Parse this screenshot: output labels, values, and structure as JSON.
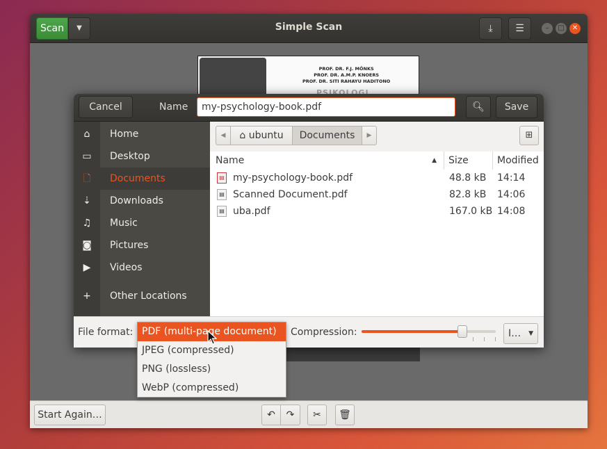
{
  "app": {
    "title": "Simple Scan",
    "scan_label": "Scan"
  },
  "preview_text": {
    "line1": "PROF. DR. F.J. MÖNKS",
    "line2": "PROF. DR. A.M.P. KNOERS",
    "line3": "PROF. DR. SITI RAHAYU HADITONO",
    "title": "PSIKOLOGI"
  },
  "footer": {
    "start_again_label": "Start Again…"
  },
  "dialog": {
    "cancel_label": "Cancel",
    "name_label": "Name",
    "name_value": "my-psychology-book.pdf",
    "save_label": "Save"
  },
  "sidebar": {
    "items": [
      {
        "label": "Home",
        "icon": "home-icon"
      },
      {
        "label": "Desktop",
        "icon": "desktop-icon"
      },
      {
        "label": "Documents",
        "icon": "document-icon"
      },
      {
        "label": "Downloads",
        "icon": "download-icon"
      },
      {
        "label": "Music",
        "icon": "music-icon"
      },
      {
        "label": "Pictures",
        "icon": "camera-icon"
      },
      {
        "label": "Videos",
        "icon": "video-icon"
      },
      {
        "label": "Other Locations",
        "icon": "plus-icon"
      }
    ]
  },
  "pathbar": {
    "segments": [
      "ubuntu",
      "Documents"
    ]
  },
  "columns": {
    "name": "Name",
    "size": "Size",
    "modified": "Modified"
  },
  "files": [
    {
      "name": "my-psychology-book.pdf",
      "size": "48.8 kB",
      "modified": "14:14"
    },
    {
      "name": "Scanned Document.pdf",
      "size": "82.8 kB",
      "modified": "14:06"
    },
    {
      "name": "uba.pdf",
      "size": "167.0 kB",
      "modified": "14:08"
    }
  ],
  "options": {
    "file_format_label": "File format:",
    "compression_label": "Compression:",
    "compression_level": 0.75,
    "quality_value": "I…"
  },
  "format_popup": {
    "items": [
      "PDF (multi-page document)",
      "JPEG (compressed)",
      "PNG (lossless)",
      "WebP (compressed)"
    ],
    "selected_index": 0
  },
  "colors": {
    "accent": "#e95420",
    "scan_green": "#3b8c38",
    "sidebar_bg": "#4a4944"
  }
}
